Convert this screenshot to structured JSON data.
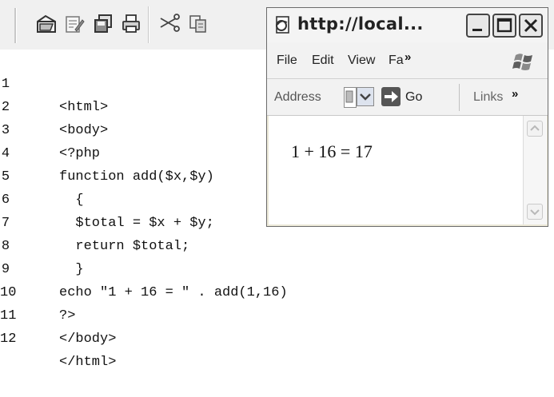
{
  "toolbar": {
    "icons": [
      "open-folder-icon",
      "edit-icon",
      "save-icon",
      "print-icon",
      "cut-icon",
      "copy-icon"
    ]
  },
  "editor": {
    "lines": [
      {
        "number": "1",
        "code": "<html>"
      },
      {
        "number": "2",
        "code": "<body>"
      },
      {
        "number": "3",
        "code": "<?php"
      },
      {
        "number": "4",
        "code": "function add($x,$y)"
      },
      {
        "number": "5",
        "code": "  {"
      },
      {
        "number": "6",
        "code": "  $total = $x + $y;"
      },
      {
        "number": "7",
        "code": "  return $total;"
      },
      {
        "number": "8",
        "code": "  }"
      },
      {
        "number": "9",
        "code": "echo \"1 + 16 = \" . add(1,16)"
      },
      {
        "number": "10",
        "code": "?>"
      },
      {
        "number": "11",
        "code": "</body>"
      },
      {
        "number": "12",
        "code": "</html>"
      }
    ]
  },
  "browser": {
    "title": "http://local...",
    "menu": {
      "file": "File",
      "edit": "Edit",
      "view": "View",
      "favorites": "Fa",
      "more": "»"
    },
    "address_bar": {
      "address_label": "Address",
      "go_label": "Go",
      "links_label": "Links",
      "more": "»"
    },
    "content": {
      "result": "1 + 16 = 17"
    }
  },
  "colors": {
    "toolbar_bg": "#f0f0f0",
    "window_bg": "#ece9d8",
    "window_border": "#6b6b6b"
  }
}
